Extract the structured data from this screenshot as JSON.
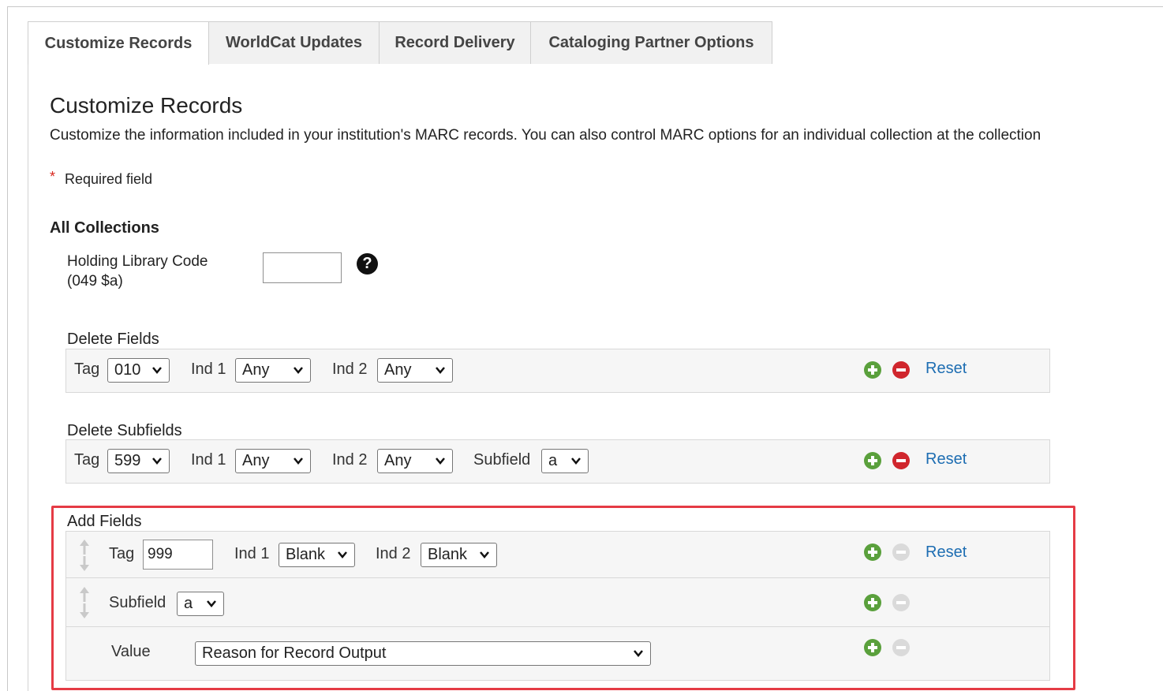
{
  "tabs": [
    {
      "label": "Customize Records",
      "active": true
    },
    {
      "label": "WorldCat Updates",
      "active": false
    },
    {
      "label": "Record Delivery",
      "active": false
    },
    {
      "label": "Cataloging Partner Options",
      "active": false
    }
  ],
  "page": {
    "title": "Customize Records",
    "description": "Customize the information included in your institution's MARC records. You can also control MARC options for an individual collection at the collection",
    "required_star": "*",
    "required_text": "Required field"
  },
  "all_collections": {
    "heading": "All Collections",
    "holding_label_line1": "Holding Library Code",
    "holding_label_line2": "(049 $a)",
    "holding_value": "",
    "help_icon": "?"
  },
  "delete_fields": {
    "label": "Delete Fields",
    "tag_label": "Tag",
    "tag_value": "010",
    "ind1_label": "Ind 1",
    "ind1_value": "Any",
    "ind2_label": "Ind 2",
    "ind2_value": "Any",
    "reset": "Reset"
  },
  "delete_subfields": {
    "label": "Delete Subfields",
    "tag_label": "Tag",
    "tag_value": "599",
    "ind1_label": "Ind 1",
    "ind1_value": "Any",
    "ind2_label": "Ind 2",
    "ind2_value": "Any",
    "subfield_label": "Subfield",
    "subfield_value": "a",
    "reset": "Reset"
  },
  "add_fields": {
    "label": "Add Fields",
    "tag_label": "Tag",
    "tag_value": "999",
    "ind1_label": "Ind 1",
    "ind1_value": "Blank",
    "ind2_label": "Ind 2",
    "ind2_value": "Blank",
    "reset": "Reset",
    "subfield_label": "Subfield",
    "subfield_value": "a",
    "value_label": "Value",
    "value_value": "Reason for Record Output"
  },
  "colors": {
    "accent_link": "#1d6db2",
    "add_green": "#5aa03c",
    "remove_red": "#d0262d",
    "highlight": "#e53b45"
  },
  "icons": [
    "help-icon",
    "add-icon",
    "remove-icon",
    "chevron-down-icon",
    "drag-handle-icon"
  ]
}
